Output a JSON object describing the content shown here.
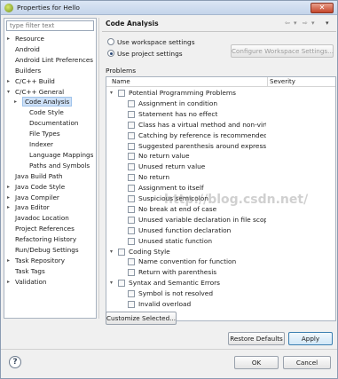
{
  "window": {
    "title": "Properties for Hello",
    "close_glyph": "✕"
  },
  "sidebar": {
    "filter_placeholder": "type filter text",
    "items": [
      {
        "label": "Resource",
        "expandable": true
      },
      {
        "label": "Android",
        "expandable": false
      },
      {
        "label": "Android Lint Preferences",
        "expandable": false
      },
      {
        "label": "Builders",
        "expandable": false
      },
      {
        "label": "C/C++ Build",
        "expandable": true
      },
      {
        "label": "C/C++ General",
        "expandable": true,
        "expanded": true
      },
      {
        "label": "Code Analysis",
        "expandable": true,
        "selected": true
      },
      {
        "label": "Code Style",
        "expandable": false
      },
      {
        "label": "Documentation",
        "expandable": false
      },
      {
        "label": "File Types",
        "expandable": false
      },
      {
        "label": "Indexer",
        "expandable": false
      },
      {
        "label": "Language Mappings",
        "expandable": false
      },
      {
        "label": "Paths and Symbols",
        "expandable": false
      },
      {
        "label": "Java Build Path",
        "expandable": false
      },
      {
        "label": "Java Code Style",
        "expandable": true
      },
      {
        "label": "Java Compiler",
        "expandable": true
      },
      {
        "label": "Java Editor",
        "expandable": true
      },
      {
        "label": "Javadoc Location",
        "expandable": false
      },
      {
        "label": "Project References",
        "expandable": false
      },
      {
        "label": "Refactoring History",
        "expandable": false
      },
      {
        "label": "Run/Debug Settings",
        "expandable": false
      },
      {
        "label": "Task Repository",
        "expandable": true
      },
      {
        "label": "Task Tags",
        "expandable": false
      },
      {
        "label": "Validation",
        "expandable": true
      }
    ]
  },
  "page": {
    "title": "Code Analysis",
    "nav_back": "⇦",
    "nav_back_menu": "▾",
    "nav_forward": "⇨",
    "nav_forward_menu": "▾",
    "nav_menu": "▾",
    "use_workspace_label": "Use workspace settings",
    "use_project_label": "Use project settings",
    "configure_workspace_label": "Configure Workspace Settings...",
    "problems_label": "Problems",
    "col_name": "Name",
    "col_severity": "Severity",
    "customize_label": "Customize Selected...",
    "restore_label": "Restore Defaults",
    "apply_label": "Apply"
  },
  "problems": [
    {
      "level": 0,
      "type": "group",
      "name": "Potential Programming Problems"
    },
    {
      "level": 1,
      "name": "Assignment in condition",
      "severity": "Warning",
      "icon": "warning-icon"
    },
    {
      "level": 1,
      "name": "Statement has no effect",
      "severity": "Warning",
      "icon": "warning-icon"
    },
    {
      "level": 1,
      "name": "Class has a virtual method and non-virtu",
      "severity": "Warning",
      "icon": "warning-icon"
    },
    {
      "level": 1,
      "name": "Catching by reference is recommended",
      "severity": "Warning",
      "icon": "warning-icon"
    },
    {
      "level": 1,
      "name": "Suggested parenthesis around expressi",
      "severity": "Warning",
      "icon": "warning-icon"
    },
    {
      "level": 1,
      "name": "No return value",
      "severity": "Error",
      "icon": "error-icon"
    },
    {
      "level": 1,
      "name": "Unused return value",
      "severity": "Error",
      "icon": "error-icon"
    },
    {
      "level": 1,
      "name": "No return",
      "severity": "Warning",
      "icon": "warning-icon"
    },
    {
      "level": 1,
      "name": "Assignment to itself",
      "severity": "Error",
      "icon": "error-icon"
    },
    {
      "level": 1,
      "name": "Suspicious semicolon",
      "severity": "Warning",
      "icon": "warning-icon"
    },
    {
      "level": 1,
      "name": "No break at end of case",
      "severity": "Warning",
      "icon": "warning-icon"
    },
    {
      "level": 1,
      "name": "Unused variable declaration in file scope",
      "severity": "Warning",
      "icon": "warning-icon"
    },
    {
      "level": 1,
      "name": "Unused function declaration",
      "severity": "Warning",
      "icon": "warning-icon"
    },
    {
      "level": 1,
      "name": "Unused static function",
      "severity": "Warning",
      "icon": "warning-icon"
    },
    {
      "level": 0,
      "type": "group",
      "name": "Coding Style"
    },
    {
      "level": 1,
      "name": "Name convention for function",
      "severity": "Info",
      "icon": "info-icon"
    },
    {
      "level": 1,
      "name": "Return with parenthesis",
      "severity": "Warning",
      "icon": "warning-icon"
    },
    {
      "level": 0,
      "type": "group",
      "name": "Syntax and Semantic Errors"
    },
    {
      "level": 1,
      "name": "Symbol is not resolved",
      "severity": "Error",
      "icon": "error-icon"
    },
    {
      "level": 1,
      "name": "Invalid overload",
      "severity": "Error",
      "icon": "error-icon"
    }
  ],
  "watermark": "http://blog.csdn.net/",
  "footer": {
    "help_glyph": "?",
    "ok_label": "OK",
    "cancel_label": "Cancel"
  },
  "colors": {
    "warning": "#e89b00",
    "error": "#d93a2b",
    "info": "#2f6fd0",
    "selection": "#cde0f7"
  }
}
